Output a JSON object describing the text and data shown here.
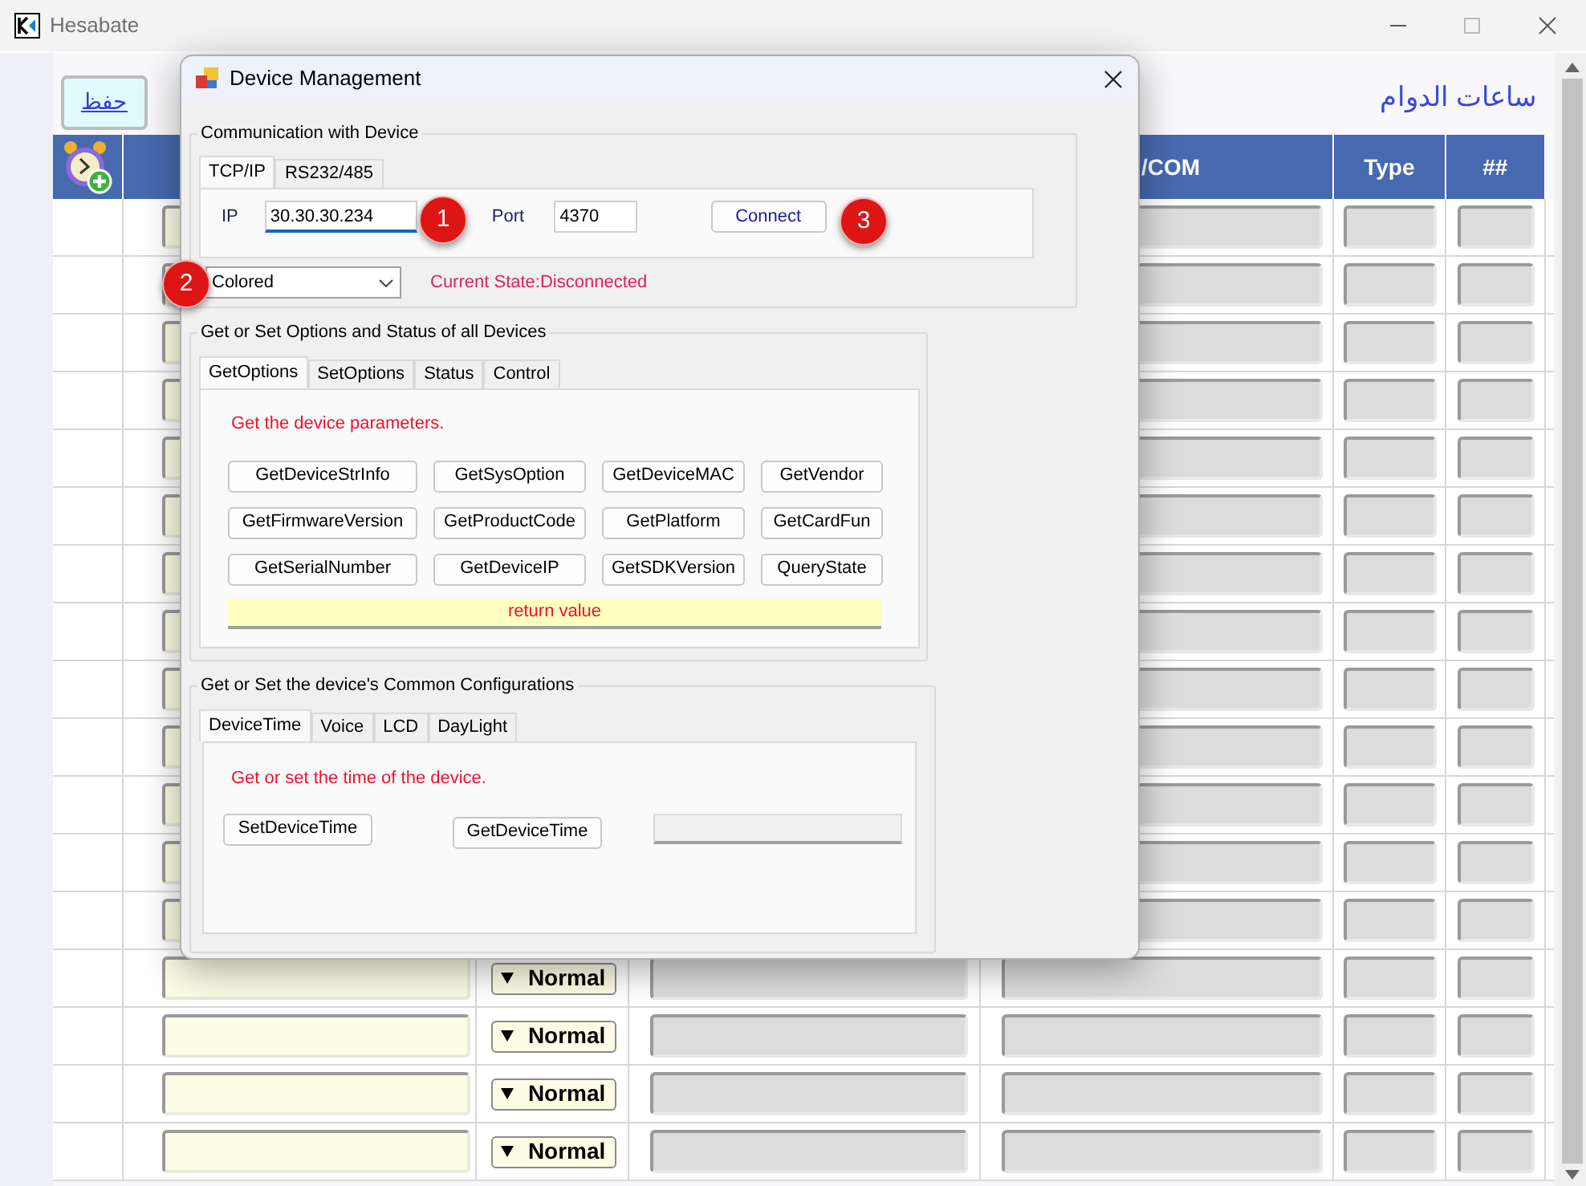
{
  "window": {
    "title": "Hesabate"
  },
  "page": {
    "save_button": "حفظ",
    "title": "ساعات الدوام"
  },
  "table": {
    "columns": [
      {
        "label": "/COM"
      },
      {
        "label": "Type"
      },
      {
        "label": "##"
      }
    ],
    "rows": [
      {
        "kind": "covered"
      },
      {
        "kind": "covered"
      },
      {
        "kind": "covered"
      },
      {
        "kind": "covered"
      },
      {
        "kind": "covered"
      },
      {
        "kind": "covered"
      },
      {
        "kind": "covered"
      },
      {
        "kind": "covered"
      },
      {
        "kind": "covered"
      },
      {
        "kind": "covered"
      },
      {
        "kind": "covered"
      },
      {
        "kind": "covered"
      },
      {
        "kind": "covered"
      },
      {
        "kind": "priority",
        "priority": "Normal"
      },
      {
        "kind": "priority",
        "priority": "Normal"
      },
      {
        "kind": "priority",
        "priority": "Normal"
      },
      {
        "kind": "priority",
        "priority": "Normal"
      }
    ]
  },
  "dialog": {
    "title": "Device Management",
    "communication": {
      "legend": "Communication with Device",
      "tabs": [
        {
          "label": "TCP/IP",
          "selected": true
        },
        {
          "label": "RS232/485",
          "selected": false
        }
      ],
      "ip_label": "IP",
      "ip": "30.30.30.234",
      "port_label": "Port",
      "port": "4370",
      "connect_button": "Connect",
      "mode": "Colored",
      "state": "Current State:Disconnected",
      "step_badges": [
        "1",
        "2",
        "3"
      ]
    },
    "options": {
      "legend": "Get or Set Options and Status of all Devices",
      "tabs": [
        {
          "label": "GetOptions",
          "selected": true
        },
        {
          "label": "SetOptions",
          "selected": false
        },
        {
          "label": "Status",
          "selected": false
        },
        {
          "label": "Control",
          "selected": false
        }
      ],
      "hint": "Get the device parameters.",
      "buttons": [
        "GetDeviceStrInfo",
        "GetSysOption",
        "GetDeviceMAC",
        "GetVendor",
        "GetFirmwareVersion",
        "GetProductCode",
        "GetPlatform",
        "GetCardFun",
        "GetSerialNumber",
        "GetDeviceIP",
        "GetSDKVersion",
        "QueryState"
      ],
      "return_value": "return value"
    },
    "config": {
      "legend": "Get or Set the device's Common Configurations",
      "tabs": [
        {
          "label": "DeviceTime",
          "selected": true
        },
        {
          "label": "Voice",
          "selected": false
        },
        {
          "label": "LCD",
          "selected": false
        },
        {
          "label": "DayLight",
          "selected": false
        }
      ],
      "hint": "Get or set the time of the device.",
      "buttons": [
        "SetDeviceTime",
        "GetDeviceTime"
      ]
    }
  }
}
